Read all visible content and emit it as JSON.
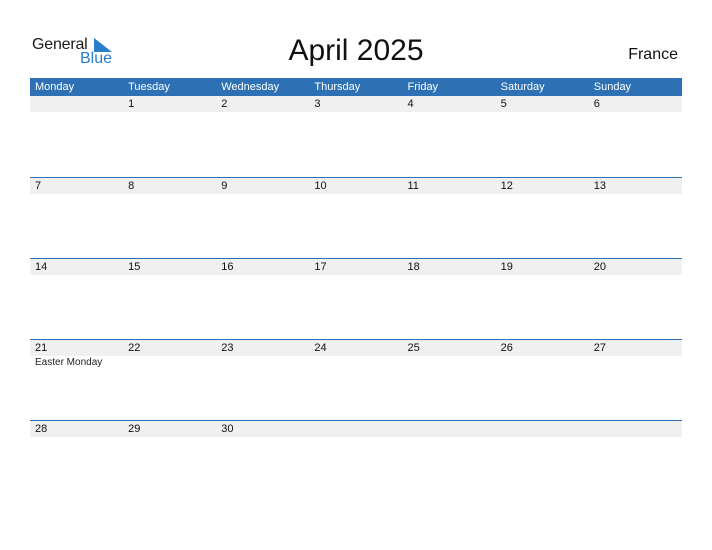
{
  "logo": {
    "general": "General",
    "blue": "Blue"
  },
  "title": "April 2025",
  "country": "France",
  "colors": {
    "accent": "#2d71b4",
    "logo_blue": "#2a7dc9",
    "day_strip": "#f0f0f0"
  },
  "weekdays": [
    "Monday",
    "Tuesday",
    "Wednesday",
    "Thursday",
    "Friday",
    "Saturday",
    "Sunday"
  ],
  "weeks": [
    [
      {
        "day": ""
      },
      {
        "day": "1"
      },
      {
        "day": "2"
      },
      {
        "day": "3"
      },
      {
        "day": "4"
      },
      {
        "day": "5"
      },
      {
        "day": "6"
      }
    ],
    [
      {
        "day": "7"
      },
      {
        "day": "8"
      },
      {
        "day": "9"
      },
      {
        "day": "10"
      },
      {
        "day": "11"
      },
      {
        "day": "12"
      },
      {
        "day": "13"
      }
    ],
    [
      {
        "day": "14"
      },
      {
        "day": "15"
      },
      {
        "day": "16"
      },
      {
        "day": "17"
      },
      {
        "day": "18"
      },
      {
        "day": "19"
      },
      {
        "day": "20"
      }
    ],
    [
      {
        "day": "21",
        "holiday": "Easter Monday"
      },
      {
        "day": "22"
      },
      {
        "day": "23"
      },
      {
        "day": "24"
      },
      {
        "day": "25"
      },
      {
        "day": "26"
      },
      {
        "day": "27"
      }
    ],
    [
      {
        "day": "28"
      },
      {
        "day": "29"
      },
      {
        "day": "30"
      },
      {
        "day": ""
      },
      {
        "day": ""
      },
      {
        "day": ""
      },
      {
        "day": ""
      }
    ]
  ]
}
